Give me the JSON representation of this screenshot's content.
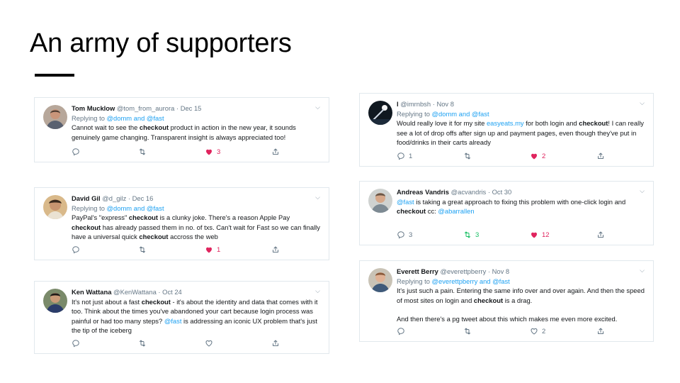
{
  "slide": {
    "title": "An army of supporters"
  },
  "tweets": [
    {
      "name": "Tom Mucklow",
      "handle": "@tom_from_aurora",
      "date": "Dec 15",
      "reply_prefix": "Replying to ",
      "reply_to": "@domm and @fast",
      "t1": "Cannot wait to see the ",
      "k1": "checkout",
      "t2": " product in action in the new year, it sounds genuinely game changing. Transparent insight is always appreciated too!",
      "replies": "",
      "retweets": "",
      "likes": "3"
    },
    {
      "name": "David Gil",
      "handle": "@d_gilz",
      "date": "Dec 16",
      "reply_prefix": "Replying to ",
      "reply_to": "@domm and @fast",
      "t1": "PayPal's \"express\" ",
      "k1": "checkout",
      "t2": " is a clunky joke. There's a reason Apple Pay ",
      "k2": "checkout",
      "t3": " has already passed them in no. of txs. Can't wait for Fast so we can finally have a universal quick ",
      "k3": "checkout",
      "t4": " accross the web",
      "replies": "",
      "retweets": "",
      "likes": "1"
    },
    {
      "name": "Ken Wattana",
      "handle": "@KenWattana",
      "date": "Oct 24",
      "t1": "It's not just about a fast ",
      "k1": "checkout",
      "t2": " - it's about the identity and data that comes with it too. Think about the times you've abandoned your cart because login process was painful or had too many steps? ",
      "m1": "@fast",
      "t3": " is addressing an iconic UX problem that's just the tip of the iceberg",
      "replies": "",
      "retweets": "",
      "likes": ""
    },
    {
      "name": "l",
      "handle": "@imrnbsh",
      "date": "Nov 8",
      "reply_prefix": "Replying to ",
      "reply_to": "@domm and @fast",
      "t1": "Would really love it for my site ",
      "link1": "easyeats.my",
      "t2": " for both login and ",
      "k1": "checkout",
      "t3": "! I can really see a lot of drop offs after sign up and payment pages, even though they've put in food/drinks in their carts already",
      "replies": "1",
      "retweets": "",
      "likes": "2"
    },
    {
      "name": "Andreas Vandris",
      "handle": "@acvandris",
      "date": "Oct 30",
      "m1": "@fast",
      "t1": " is taking a great approach to fixing this problem with one-click login and ",
      "k1": "checkout",
      "t2": " cc: ",
      "m2": "@abarrallen",
      "replies": "3",
      "retweets": "3",
      "likes": "12"
    },
    {
      "name": "Everett Berry",
      "handle": "@everettpberry",
      "date": "Nov 8",
      "reply_prefix": "Replying to ",
      "reply_to": "@everettpberry and @fast",
      "t1": "It's just such a pain. Entering the same info over and over again. And then the speed of most sites on login and ",
      "k1": "checkout",
      "t2": " is a drag.",
      "t3": "And then there's a pg tweet about this which makes me even more excited.",
      "replies": "",
      "retweets": "",
      "likes": "2"
    }
  ],
  "colors": {
    "like": "#e0245e",
    "retweet": "#17bf63",
    "link": "#1da1f2",
    "muted": "#657786"
  },
  "icons": [
    "reply-icon",
    "retweet-icon",
    "like-icon",
    "share-icon",
    "chevron-down-icon"
  ]
}
